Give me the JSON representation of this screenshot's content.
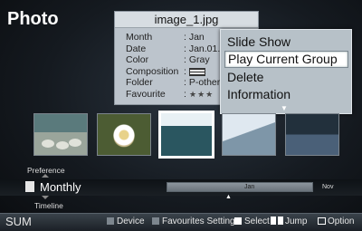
{
  "app": {
    "title": "Photo"
  },
  "info_card": {
    "filename": "image_1.jpg",
    "rows": [
      {
        "key": "Month",
        "value": ": Jan"
      },
      {
        "key": "Date",
        "value": ": Jan.01.2"
      },
      {
        "key": "Color",
        "value": ": Gray"
      },
      {
        "key": "Composition",
        "value": ":"
      },
      {
        "key": "Folder",
        "value": ": P-other"
      },
      {
        "key": "Favourite",
        "value": ":"
      }
    ],
    "favourite_stars": "★★★",
    "composition_icon": "horizontal-lines-icon"
  },
  "menu": {
    "items": [
      {
        "label": "Slide Show"
      },
      {
        "label": "Play Current Group"
      },
      {
        "label": "Delete"
      },
      {
        "label": "Information"
      }
    ],
    "selected_index": 1,
    "more_indicator": "▼"
  },
  "thumbnails": [
    {
      "name": "sheep"
    },
    {
      "name": "daisy"
    },
    {
      "name": "coast"
    },
    {
      "name": "snow-mountain"
    },
    {
      "name": "cliff"
    }
  ],
  "filter": {
    "preference_label": "Preference",
    "mode": "Monthly",
    "timeline_label": "Timeline",
    "current_month": "Jan",
    "next_month": "Nov",
    "caret": "▲"
  },
  "bottom_bar": {
    "sum": "SUM",
    "device": "Device",
    "favourites": "Favourites Setting",
    "select": "Select",
    "jump": "Jump",
    "option": "Option"
  },
  "colors": {
    "menu_bg": "#b7c1c8",
    "selection": "#ffffff",
    "info_bg": "#bcc4cc"
  }
}
